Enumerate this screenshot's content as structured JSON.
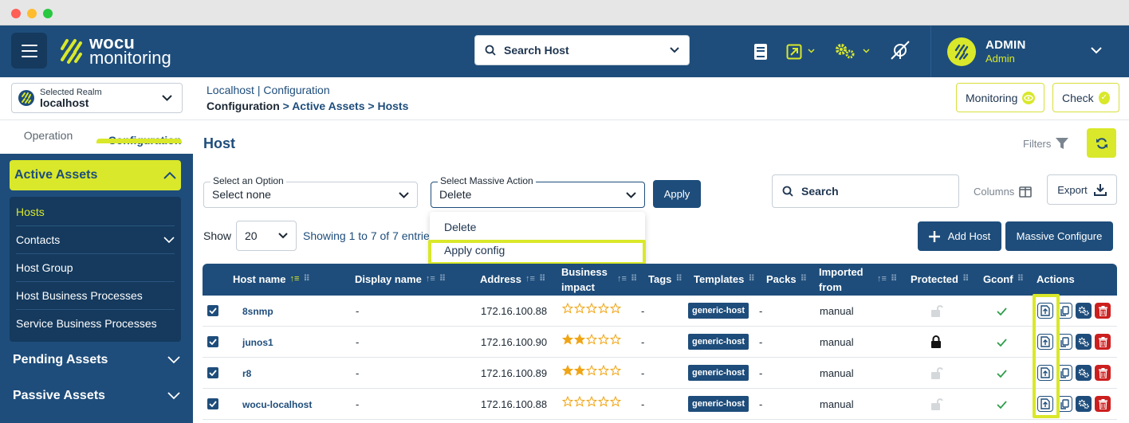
{
  "colors": {
    "primary": "#1e4d7b",
    "accent": "#d9e82a",
    "danger": "#cc1f1f"
  },
  "header": {
    "logo_line1": "wocu",
    "logo_line2": "monitoring",
    "search_host": "Search Host",
    "user_name": "ADMIN",
    "user_role": "Admin",
    "icons": [
      "book-icon",
      "external-link-icon",
      "gears-icon",
      "no-signal-icon"
    ]
  },
  "realm": {
    "label": "Selected Realm",
    "value": "localhost"
  },
  "breadcrumb": {
    "line1": "Localhost | Configuration",
    "root": "Configuration",
    "trail": " > Active Assets > Hosts"
  },
  "topbuttons": {
    "monitoring": "Monitoring",
    "check": "Check"
  },
  "sidebar": {
    "tabs": [
      "Operation",
      "Configuration"
    ],
    "active_section": "Active Assets",
    "items": [
      {
        "label": "Hosts"
      },
      {
        "label": "Contacts"
      },
      {
        "label": "Host Group"
      },
      {
        "label": "Host Business Processes"
      },
      {
        "label": "Service Business Processes"
      }
    ],
    "sections": [
      "Pending Assets",
      "Passive Assets"
    ]
  },
  "main": {
    "title": "Host",
    "filters": "Filters",
    "select_option": {
      "label": "Select an Option",
      "value": "Select none"
    },
    "massive_action": {
      "label": "Select Massive Action",
      "value": "Delete",
      "options": [
        "Delete",
        "Apply config"
      ]
    },
    "apply": "Apply",
    "search": "Search",
    "columns": "Columns",
    "export": "Export",
    "show_label": "Show",
    "show_value": "20",
    "showing_text": "Showing 1 to 7 of 7 entries",
    "add_host": "Add Host",
    "massive_configure": "Massive Configure"
  },
  "table": {
    "headers": {
      "host_name": "Host name",
      "display_name": "Display name",
      "address": "Address",
      "business_impact": "Business impact",
      "tags": "Tags",
      "templates": "Templates",
      "packs": "Packs",
      "imported_from": "Imported from",
      "protected": "Protected",
      "gconf": "Gconf",
      "actions": "Actions"
    },
    "rows": [
      {
        "host": "8snmp",
        "display": "-",
        "address": "172.16.100.88",
        "impact": 0,
        "tags": "-",
        "template": "generic-host",
        "packs": "-",
        "imported": "manual",
        "protected": false
      },
      {
        "host": "junos1",
        "display": "-",
        "address": "172.16.100.90",
        "impact": 2,
        "tags": "-",
        "template": "generic-host",
        "packs": "-",
        "imported": "manual",
        "protected": true
      },
      {
        "host": "r8",
        "display": "-",
        "address": "172.16.100.89",
        "impact": 2,
        "tags": "-",
        "template": "generic-host",
        "packs": "-",
        "imported": "manual",
        "protected": false
      },
      {
        "host": "wocu-localhost",
        "display": "-",
        "address": "172.16.100.88",
        "impact": 0,
        "tags": "-",
        "template": "generic-host",
        "packs": "-",
        "imported": "manual",
        "protected": false
      }
    ]
  }
}
